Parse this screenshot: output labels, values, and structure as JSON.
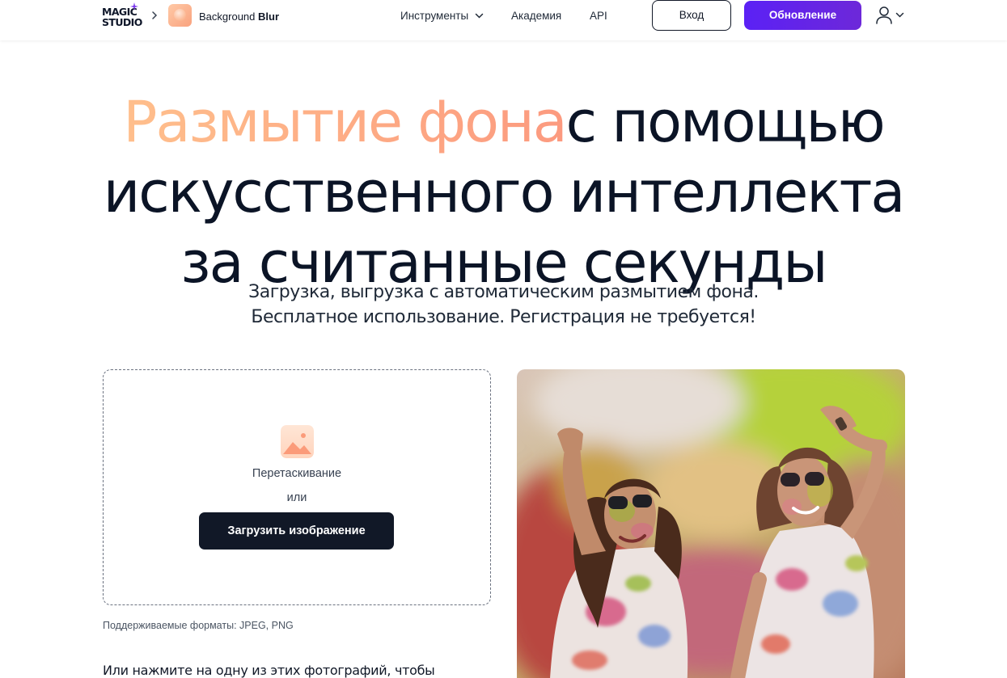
{
  "header": {
    "logo": {
      "line1": "MAGIC",
      "line2": "STUDIO"
    },
    "app_name_regular": "Background ",
    "app_name_bold": "Blur",
    "nav": {
      "tools": "Инструменты",
      "academy": "Академия",
      "api": "API"
    },
    "login_label": "Вход",
    "upgrade_label": "Обновление"
  },
  "hero": {
    "title_accent": "Размытие фона",
    "title_rest_line1": "с помощью",
    "title_line2": "искусственного интеллекта",
    "title_line3": "за считанные секунды",
    "subtitle_line1": "Загрузка, выгрузка с автоматическим размытием фона.",
    "subtitle_line2": "Бесплатное использование. Регистрация не требуется!"
  },
  "upload": {
    "drag_label": "Перетаскивание",
    "or_label": "или",
    "button_label": "Загрузить изображение",
    "formats": "Поддерживаемые форматы: JPEG, PNG",
    "samples_text": "Или нажмите на одну из этих фотографий, чтобы"
  },
  "icons": {
    "logo_spark": "sparkle-icon",
    "breadcrumb": "chevron-right-icon",
    "app": "background-blur-app-icon",
    "tools_dropdown": "chevron-down-icon",
    "user": "user-icon",
    "user_dropdown": "chevron-down-icon",
    "upload_placeholder": "image-icon"
  },
  "colors": {
    "accent_gradient_start": "#ffbf8c",
    "accent_gradient_end": "#fc9a7f",
    "upgrade_button": "#5b21f5",
    "dark": "#111827"
  }
}
